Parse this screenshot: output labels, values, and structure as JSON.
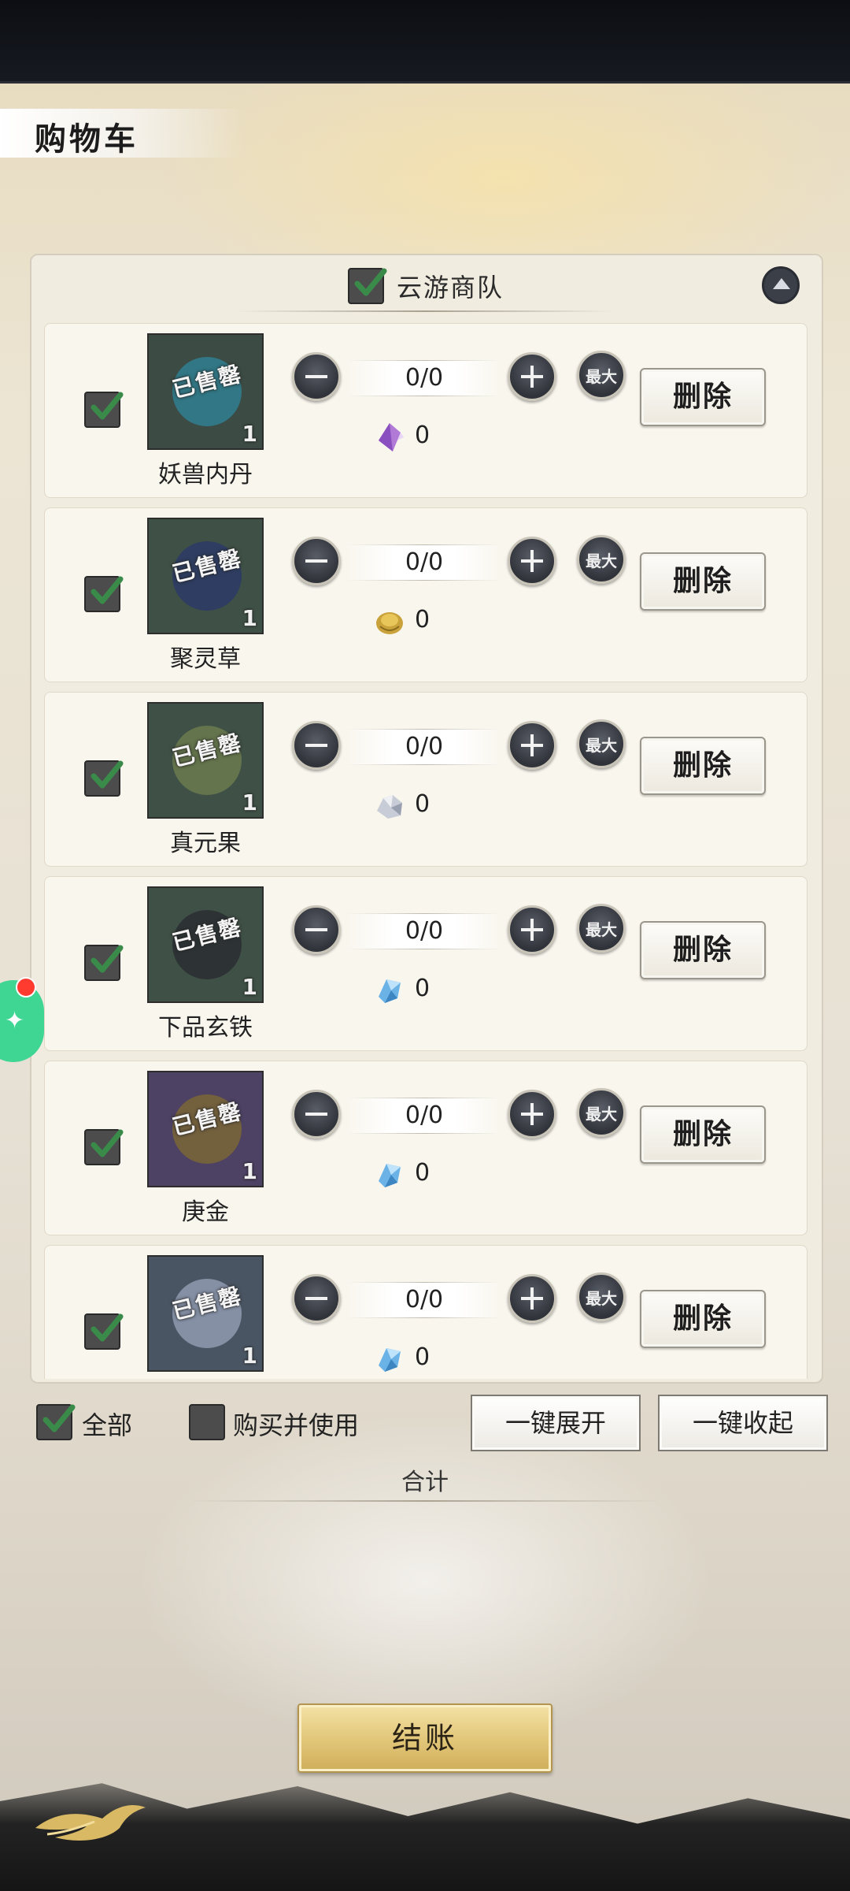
{
  "page": {
    "title": "购物车"
  },
  "group": {
    "name": "云游商队",
    "checked": true
  },
  "items": [
    {
      "name": "妖兽内丹",
      "sold_label": "已售罄",
      "stock": "1",
      "quantity": "0/0",
      "price": "0",
      "currency_icon": "purple-crystal-icon",
      "image_color": "#3c4b44",
      "blob_color": "#2f7f90",
      "delete_label": "删除"
    },
    {
      "name": "聚灵草",
      "sold_label": "已售罄",
      "stock": "1",
      "quantity": "0/0",
      "price": "0",
      "currency_icon": "gold-ingot-icon",
      "image_color": "#3f5046",
      "blob_color": "#2b3a66",
      "delete_label": "删除"
    },
    {
      "name": "真元果",
      "sold_label": "已售罄",
      "stock": "1",
      "quantity": "0/0",
      "price": "0",
      "currency_icon": "silver-ore-icon",
      "image_color": "#3f5046",
      "blob_color": "#6b7a4e",
      "delete_label": "删除"
    },
    {
      "name": "下品玄铁",
      "sold_label": "已售罄",
      "stock": "1",
      "quantity": "0/0",
      "price": "0",
      "currency_icon": "blue-crystal-icon",
      "image_color": "#3f5046",
      "blob_color": "#2a2e32",
      "delete_label": "删除"
    },
    {
      "name": "庚金",
      "sold_label": "已售罄",
      "stock": "1",
      "quantity": "0/0",
      "price": "0",
      "currency_icon": "blue-crystal-icon",
      "image_color": "#4d4263",
      "blob_color": "#7a6536",
      "delete_label": "删除"
    },
    {
      "name": "",
      "sold_label": "已售罄",
      "stock": "1",
      "quantity": "0/0",
      "price": "0",
      "currency_icon": "blue-crystal-icon",
      "image_color": "#4a5563",
      "blob_color": "#8f9bb0",
      "delete_label": "删除"
    }
  ],
  "controls": {
    "max_label": "最大"
  },
  "footer": {
    "select_all_label": "全部",
    "select_all_checked": true,
    "buy_and_use_label": "购买并使用",
    "buy_and_use_checked": false,
    "expand_all_label": "一键展开",
    "collapse_all_label": "一键收起",
    "total_label": "合计",
    "checkout_label": "结账"
  }
}
